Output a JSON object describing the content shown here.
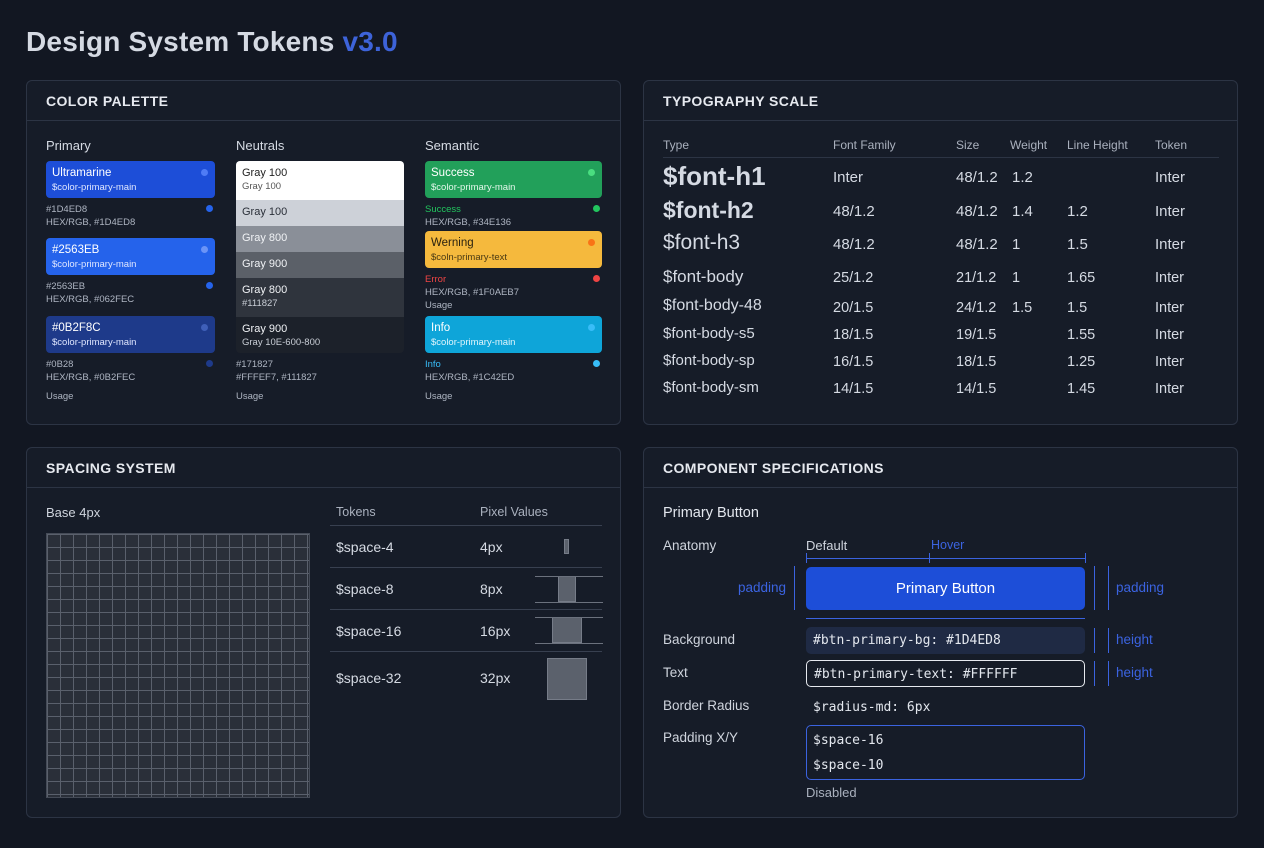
{
  "page": {
    "title": "Design System Tokens",
    "version": "v3.0"
  },
  "color_palette": {
    "title": "COLOR PALETTE",
    "columns": {
      "primary": "Primary",
      "neutrals": "Neutrals",
      "semantic": "Semantic"
    },
    "primary": [
      {
        "name": "Ultramarine",
        "token": "$color-primary-main",
        "hex": "#1D4ED8",
        "rgb": "HEX/RGB, #1D4ED8",
        "color": "#1d4ed8"
      },
      {
        "name": "#2563EB",
        "token": "$color-primary-main",
        "hex": "#2563EB",
        "rgb": "HEX/RGB, #062FEC",
        "color": "#2563eb"
      },
      {
        "name": "#0B2F8C",
        "token": "$color-primary-main",
        "hex": "#0B28",
        "rgb": "HEX/RGB, #0B2FEC",
        "color": "#1e3a8a"
      }
    ],
    "primary_usage": "Usage",
    "neutrals": [
      {
        "name": "Gray 100",
        "sub": "Gray 100",
        "bg": "#ffffff",
        "fg": "#222222"
      },
      {
        "name": "Gray 100",
        "sub": "",
        "bg": "#cdd1d8",
        "fg": "#2a2f38"
      },
      {
        "name": "Gray 800",
        "sub": "",
        "bg": "#8a8f98",
        "fg": "#f0f2f5"
      },
      {
        "name": "Gray 900",
        "sub": "",
        "bg": "#5b6068",
        "fg": "#f0f2f5"
      },
      {
        "name": "Gray 800",
        "sub": "#111827",
        "bg": "#2f343d",
        "fg": "#f0f2f5"
      },
      {
        "name": "Gray 900",
        "sub": "Gray 10E-600-800",
        "bg": "#1c212a",
        "fg": "#f0f2f5"
      }
    ],
    "neutrals_meta": {
      "line1": "#171827",
      "line2": "#FFFEF7, #111827",
      "usage": "Usage"
    },
    "semantic": [
      {
        "name": "Success",
        "token": "$color-primary-main",
        "bg": "#22a05a",
        "fg": "#ffffff",
        "dot": "#4ade80"
      },
      {
        "name": "Werning",
        "token": "$coln-primary-text",
        "bg": "#f5b93d",
        "fg": "#2a2210",
        "dot": "#f97316"
      },
      {
        "name": "Info",
        "token": "$color-primary-main",
        "bg": "#0ea5d9",
        "fg": "#ffffff",
        "dot": "#38bdf8"
      }
    ],
    "semantic_meta": {
      "success_label": "Success",
      "success_hex": "HEX/RGB, #34E136",
      "error_label": "Error",
      "error_hex": "HEX/RGB, #1F0AEB7",
      "error_usage": "Usage",
      "info_label": "Info",
      "info_hex": "HEX/RGB, #1C42ED",
      "info_usage": "Usage"
    },
    "colors": {
      "success": "#22c55e",
      "error": "#ef4444",
      "info": "#38bdf8"
    }
  },
  "typography": {
    "title": "TYPOGRAPHY SCALE",
    "headers": [
      "Type",
      "Font Family",
      "Size",
      "Weight",
      "Line Height",
      "Token"
    ],
    "rows": [
      {
        "type": "$font-h1",
        "family": "Inter",
        "size": "48/1.2",
        "weight": "1.2",
        "line": "",
        "token": "Inter"
      },
      {
        "type": "$font-h2",
        "family": "48/1.2",
        "size": "48/1.2",
        "weight": "1.4",
        "line": "1.2",
        "token": "Inter"
      },
      {
        "type": "$font-h3",
        "family": "48/1.2",
        "size": "48/1.2",
        "weight": "1",
        "line": "1.5",
        "token": "Inter"
      },
      {
        "type": "$font-body",
        "family": "25/1.2",
        "size": "21/1.2",
        "weight": "1",
        "line": "1.65",
        "token": "Inter"
      },
      {
        "type": "$font-body-48",
        "family": "20/1.5",
        "size": "24/1.2",
        "weight": "1.5",
        "line": "1.5",
        "token": "Inter"
      },
      {
        "type": "$font-body-s5",
        "family": "18/1.5",
        "size": "19/1.5",
        "weight": "",
        "line": "1.55",
        "token": "Inter"
      },
      {
        "type": "$font-body-sp",
        "family": "16/1.5",
        "size": "18/1.5",
        "weight": "",
        "line": "1.25",
        "token": "Inter"
      },
      {
        "type": "$font-body-sm",
        "family": "14/1.5",
        "size": "14/1.5",
        "weight": "",
        "line": "1.45",
        "token": "Inter"
      }
    ]
  },
  "spacing": {
    "title": "SPACING SYSTEM",
    "base": "Base 4px",
    "headers": [
      "Tokens",
      "Pixel Values"
    ],
    "rows": [
      {
        "token": "$space-4",
        "value": "4px"
      },
      {
        "token": "$space-8",
        "value": "8px"
      },
      {
        "token": "$space-16",
        "value": "16px"
      },
      {
        "token": "$space-32",
        "value": "32px"
      }
    ]
  },
  "component": {
    "title": "COMPONENT SPECIFICATIONS",
    "subtitle": "Primary Button",
    "labels": {
      "anatomy": "Anatomy",
      "background": "Background",
      "text": "Text",
      "radius": "Border Radius",
      "padding": "Padding X/Y"
    },
    "states": {
      "default": "Default",
      "hover": "Hover",
      "disabled": "Disabled"
    },
    "button_label": "Primary Button",
    "annotations": {
      "padding_left": "padding",
      "padding_right": "padding",
      "height_1": "height",
      "height_2": "height"
    },
    "tokens": {
      "bg": "#btn-primary-bg: #1D4ED8",
      "text": "#btn-primary-text: #FFFFFF",
      "radius": "$radius-md: 6px",
      "pad_x": "$space-16",
      "pad_y": "$space-10"
    },
    "colors": {
      "button": "#1d4ed8",
      "accent": "#3b63e0"
    }
  }
}
